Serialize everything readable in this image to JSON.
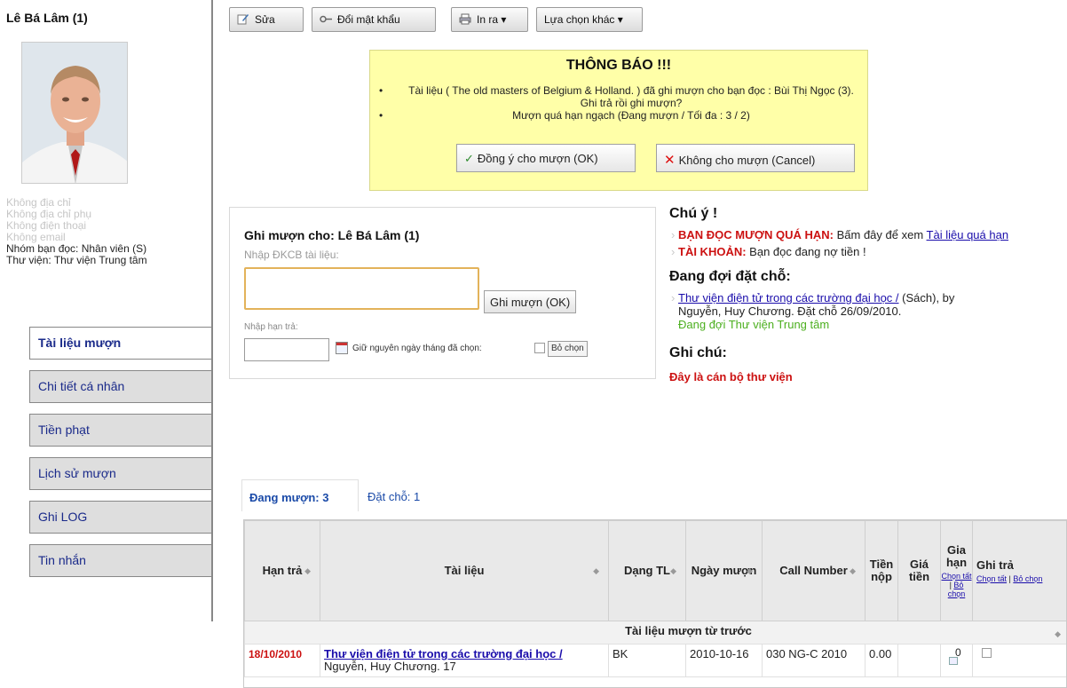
{
  "patron": {
    "name": "Lê Bá Lâm (1)",
    "info_muted": [
      "Không địa chỉ",
      "Không địa chỉ phụ",
      "Không điện thoại",
      "Không email"
    ],
    "info": [
      "Nhóm bạn đọc: Nhân viên (S)",
      "Thư viện: Thư viện Trung tâm"
    ]
  },
  "sidebar": {
    "items": [
      {
        "label": "Tài liệu mượn"
      },
      {
        "label": "Chi tiết cá nhân"
      },
      {
        "label": "Tiền phạt"
      },
      {
        "label": "Lịch sử mượn"
      },
      {
        "label": "Ghi LOG"
      },
      {
        "label": "Tin nhắn"
      }
    ]
  },
  "toolbar": {
    "edit": "Sửa",
    "change_password": "Đổi mật khẩu",
    "print": "In ra ▾",
    "more": "Lựa chọn khác ▾"
  },
  "notice": {
    "title": "THÔNG BÁO !!!",
    "line1": "Tài liệu ( The old masters of Belgium & Holland. ) đã ghi mượn cho bạn đọc : Bùi Thị Ngọc (3). Ghi trả rồi ghi mượn?",
    "line2": "Mượn quá hạn ngạch (Đang mượn / Tối đa : 3 / 2)",
    "ok": "Đồng ý cho mượn (OK)",
    "cancel": "Không cho mượn (Cancel)"
  },
  "checkout": {
    "title": "Ghi mượn cho: Lê Bá Lâm (1)",
    "barcode_label": "Nhập ĐKCB tài liệu:",
    "barcode_value": "",
    "ok": "Ghi mượn (OK)",
    "due_label": "Nhập hạn trả:",
    "due_value": "",
    "keep_date": "Giữ nguyên ngày tháng đã chọn:",
    "unselect": "Bỏ chọn"
  },
  "notes": {
    "attention": "Chú ý !",
    "overdue_label": "BẠN ĐỌC MƯỢN QUÁ HẠN:",
    "overdue_text": "Bấm đây để xem",
    "overdue_link": "Tài liệu quá hạn",
    "account_label": "TÀI KHOẢN:",
    "account_text": "Bạn đọc đang nợ tiền !",
    "holds_title": "Đang đợi đặt chỗ:",
    "hold_link": "Thư viện điện tử trong các trường đại học /",
    "hold_type": "(Sách), by",
    "hold_detail": "Nguyễn, Huy Chương. Đặt chỗ 26/09/2010.",
    "hold_status": "Đang đợi Thư viện Trung tâm",
    "memo_title": "Ghi chú:",
    "memo": "Đây là cán bộ thư viện"
  },
  "tabs": [
    {
      "label": "Đang mượn: 3"
    },
    {
      "label": "Đặt chỗ: 1"
    }
  ],
  "table": {
    "headers": {
      "due": "Hạn trả",
      "item": "Tài liệu",
      "type": "Dạng TL",
      "checkout_date": "Ngày mượn",
      "call_number": "Call Number",
      "fee_paid": "Tiền nộp",
      "price": "Giá tiền",
      "renew": "Gia hạn",
      "return": "Ghi trả",
      "select_all": "Chọn tất",
      "deselect": "Bỏ chọn"
    },
    "group_label": "Tài liệu mượn từ trước",
    "rows": [
      {
        "due": "18/10/2010",
        "title": "Thư viện điện tử trong các trường đại học /",
        "author": "Nguyễn, Huy Chương. 17",
        "type": "BK",
        "checkout_date": "2010-10-16",
        "call_number": "030 NG-C 2010",
        "fee": "0.00",
        "price": "",
        "renewals": "0"
      }
    ]
  },
  "colors": {
    "notice_bg": "#ffffa8",
    "alert_red": "#cc1111",
    "link_blue": "#1a0dab",
    "hold_green": "#4caf1f"
  }
}
